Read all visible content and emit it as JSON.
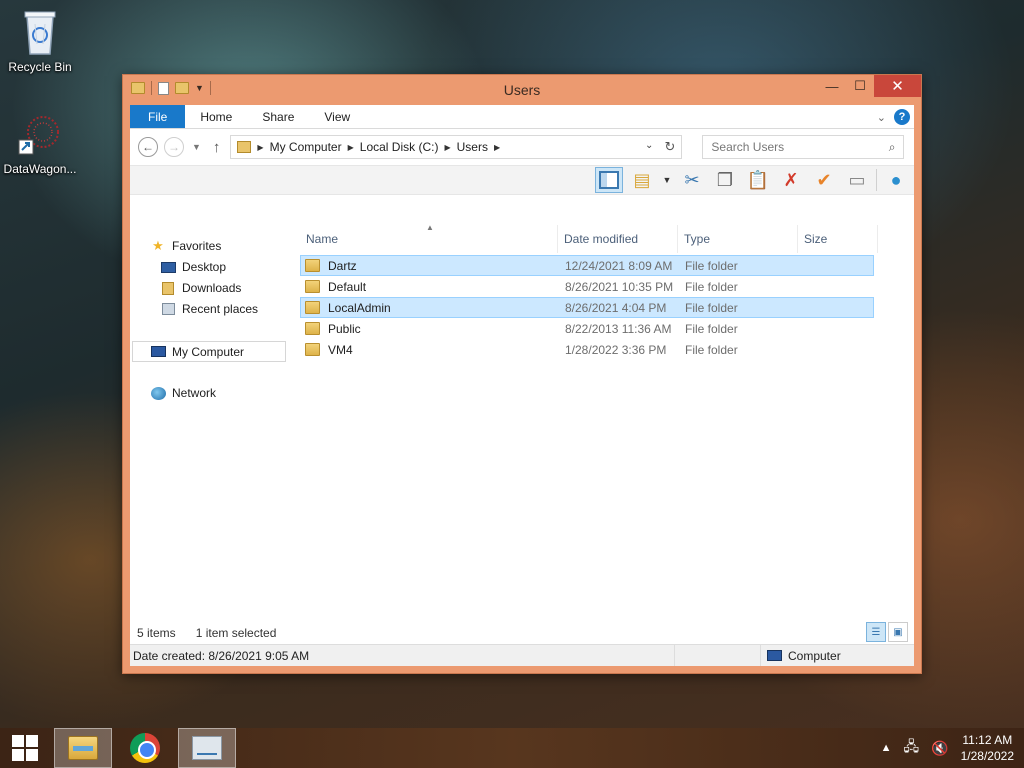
{
  "desktop": {
    "icons": [
      {
        "label": "Recycle Bin"
      },
      {
        "label": "DataWagon..."
      }
    ]
  },
  "window": {
    "title": "Users",
    "controls": {
      "minimize": "—",
      "maximize": "☐",
      "close": "✕"
    }
  },
  "ribbon": {
    "tabs": [
      "File",
      "Home",
      "Share",
      "View"
    ],
    "help": "?"
  },
  "address": {
    "crumbs": [
      "My Computer",
      "Local Disk (C:)",
      "Users"
    ],
    "search_placeholder": "Search Users"
  },
  "nav": {
    "favorites": "Favorites",
    "desktop": "Desktop",
    "downloads": "Downloads",
    "recent": "Recent places",
    "computer": "My Computer",
    "network": "Network"
  },
  "columns": {
    "name": "Name",
    "date": "Date modified",
    "type": "Type",
    "size": "Size"
  },
  "files": [
    {
      "name": "Dartz",
      "date": "12/24/2021 8:09 AM",
      "type": "File folder"
    },
    {
      "name": "Default",
      "date": "8/26/2021 10:35 PM",
      "type": "File folder"
    },
    {
      "name": "LocalAdmin",
      "date": "8/26/2021 4:04 PM",
      "type": "File folder"
    },
    {
      "name": "Public",
      "date": "8/22/2013 11:36 AM",
      "type": "File folder"
    },
    {
      "name": "VM4",
      "date": "1/28/2022 3:36 PM",
      "type": "File folder"
    }
  ],
  "status": {
    "count": "5 items",
    "selected": "1 item selected",
    "details": "Date created: 8/26/2021 9:05 AM",
    "location": "Computer"
  },
  "taskbar": {
    "time": "11:12 AM",
    "date": "1/28/2022"
  }
}
